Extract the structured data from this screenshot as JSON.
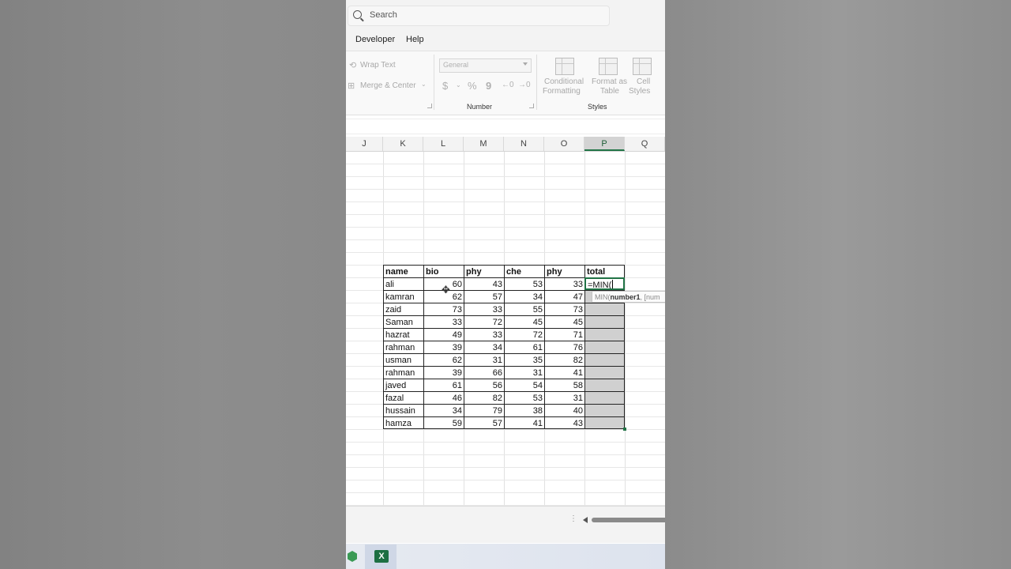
{
  "search": {
    "placeholder": "Search"
  },
  "menu": {
    "items": [
      "Developer",
      "Help"
    ]
  },
  "ribbon": {
    "wrap_text": "Wrap Text",
    "merge_center": "Merge & Center",
    "number_format_value": "General",
    "number_symbols": [
      "$",
      "%",
      "9",
      "←0",
      "→0"
    ],
    "conditional_formatting": [
      "Conditional",
      "Formatting"
    ],
    "format_as_table": [
      "Format as",
      "Table"
    ],
    "cell_styles": [
      "Cell",
      "Styles"
    ],
    "group_number": "Number",
    "group_styles": "Styles"
  },
  "columns": [
    "J",
    "K",
    "L",
    "M",
    "N",
    "O",
    "P",
    "Q"
  ],
  "active_column": "P",
  "table": {
    "headers": [
      "name",
      "bio",
      "phy",
      "che",
      "phy",
      "total"
    ],
    "rows": [
      [
        "ali",
        "60",
        "43",
        "53",
        "33"
      ],
      [
        "kamran",
        "62",
        "57",
        "34",
        "47"
      ],
      [
        "zaid",
        "73",
        "33",
        "55",
        "73"
      ],
      [
        "Saman",
        "33",
        "72",
        "45",
        "45"
      ],
      [
        "hazrat",
        "49",
        "33",
        "72",
        "71"
      ],
      [
        "rahman",
        "39",
        "34",
        "61",
        "76"
      ],
      [
        "usman",
        "62",
        "31",
        "35",
        "82"
      ],
      [
        "rahman",
        "39",
        "66",
        "31",
        "41"
      ],
      [
        "javed",
        "61",
        "56",
        "54",
        "58"
      ],
      [
        "fazal",
        "46",
        "82",
        "53",
        "31"
      ],
      [
        "hussain",
        "34",
        "79",
        "38",
        "40"
      ],
      [
        "hamza",
        "59",
        "57",
        "41",
        "43"
      ]
    ],
    "editing_formula": "=MIN("
  },
  "tooltip": {
    "func": "MIN(",
    "arg_bold": "number1",
    "rest": ", [num"
  },
  "taskbar": {
    "excel_letter": "X"
  },
  "colors": {
    "excel_green": "#217346",
    "selection_gray": "#d0d0d0"
  }
}
